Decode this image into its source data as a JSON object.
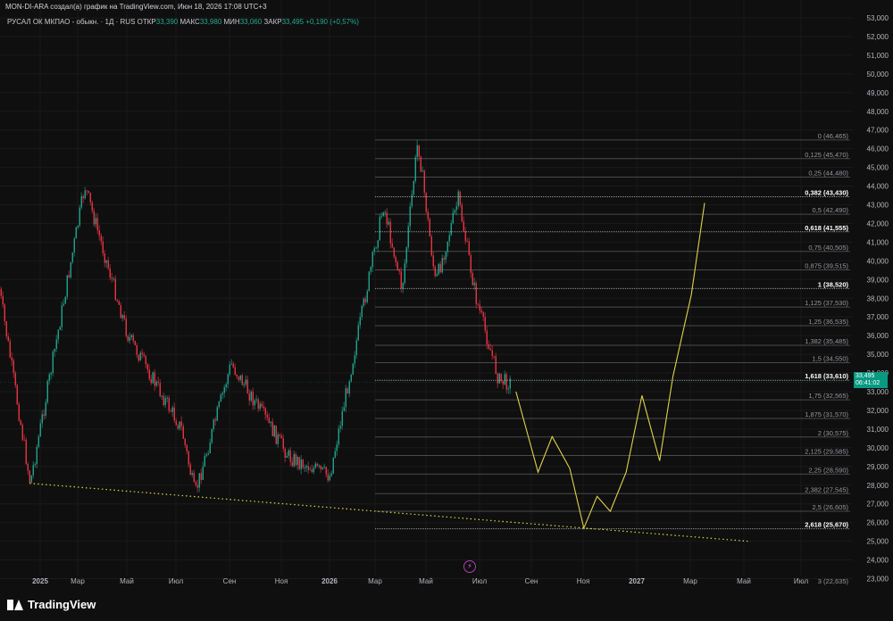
{
  "header": {
    "title": "MON-DI-ARA создал(а) график на TradingView.com, Июн 18, 2026 17:08 UTC+3"
  },
  "legend": {
    "symbol": "РУСАЛ ОК МКПАО - обыкн. · 1Д · RUS",
    "open_label": "ОТКР",
    "open": "33,390",
    "high_label": "МАКС",
    "high": "33,980",
    "low_label": "МИН",
    "low": "33,060",
    "close_label": "ЗАКР",
    "close": "33,495",
    "change": "+0,190 (+0,57%)"
  },
  "price_badge": {
    "price": "33,495",
    "countdown": "06:41:02"
  },
  "footer": {
    "brand": "TradingView"
  },
  "icons": {
    "brand_logo": "tradingview-logo-icon",
    "spark": "lightning-icon"
  },
  "colors": {
    "up": "#22ab94",
    "down": "#f23645",
    "projection": "#e0d34a",
    "trendline": "#e0d34a",
    "fib_line": "#6b6b6b",
    "badge": "#089981"
  },
  "chart_data": {
    "type": "candlestick",
    "y_axis_labels": [
      "53,000",
      "52,000",
      "51,000",
      "50,000",
      "49,000",
      "48,000",
      "47,000",
      "46,000",
      "45,000",
      "44,000",
      "43,000",
      "42,000",
      "41,000",
      "40,000",
      "39,000",
      "38,000",
      "37,000",
      "36,000",
      "35,000",
      "34,000",
      "33,000",
      "32,000",
      "31,000",
      "30,000",
      "29,000",
      "28,000",
      "27,000",
      "26,000",
      "25,000",
      "24,000",
      "23,000"
    ],
    "ylim": [
      22500,
      53000
    ],
    "x_axis_labels": [
      "2025",
      "Мар",
      "Май",
      "Июл",
      "Сен",
      "Ноя",
      "2026",
      "Мар",
      "Май",
      "Июл",
      "Сен",
      "Ноя",
      "2027",
      "Мар",
      "Май",
      "Июл"
    ],
    "price_path_key_points": [
      {
        "date": "2024-11-15",
        "price": 38500
      },
      {
        "date": "2024-12-20",
        "price": 28100
      },
      {
        "date": "2025-02-20",
        "price": 44000
      },
      {
        "date": "2025-04-10",
        "price": 36000
      },
      {
        "date": "2025-06-10",
        "price": 31000
      },
      {
        "date": "2025-06-25",
        "price": 27500
      },
      {
        "date": "2025-08-05",
        "price": 34500
      },
      {
        "date": "2025-10-10",
        "price": 29500
      },
      {
        "date": "2025-11-25",
        "price": 28500
      },
      {
        "date": "2026-01-25",
        "price": 43000
      },
      {
        "date": "2026-02-15",
        "price": 38500
      },
      {
        "date": "2026-03-05",
        "price": 46465
      },
      {
        "date": "2026-03-25",
        "price": 38800
      },
      {
        "date": "2026-04-20",
        "price": 43300
      },
      {
        "date": "2026-05-10",
        "price": 38000
      },
      {
        "date": "2026-06-05",
        "price": 33600
      },
      {
        "date": "2026-06-18",
        "price": 33495
      }
    ],
    "projection_path": [
      {
        "date": "2026-06-25",
        "price": 33000
      },
      {
        "date": "2026-07-20",
        "price": 28700
      },
      {
        "date": "2026-08-05",
        "price": 30600
      },
      {
        "date": "2026-08-25",
        "price": 28900
      },
      {
        "date": "2026-09-10",
        "price": 25700
      },
      {
        "date": "2026-09-25",
        "price": 27400
      },
      {
        "date": "2026-10-10",
        "price": 26600
      },
      {
        "date": "2026-10-28",
        "price": 28700
      },
      {
        "date": "2026-11-15",
        "price": 32800
      },
      {
        "date": "2026-12-05",
        "price": 29300
      },
      {
        "date": "2026-12-20",
        "price": 33800
      },
      {
        "date": "2027-01-10",
        "price": 38200
      },
      {
        "date": "2027-01-25",
        "price": 43100
      }
    ],
    "trendline": {
      "start": {
        "date": "2024-12-20",
        "price": 28100
      },
      "end": {
        "date": "2027-03-15",
        "price": 25000
      }
    },
    "fib_levels": [
      {
        "label": "0 (46,465)",
        "price": 46465,
        "bold": false
      },
      {
        "label": "0,125 (45,470)",
        "price": 45470,
        "bold": false
      },
      {
        "label": "0,25 (44,480)",
        "price": 44480,
        "bold": false
      },
      {
        "label": "0,382 (43,430)",
        "price": 43430,
        "bold": true
      },
      {
        "label": "0,5 (42,490)",
        "price": 42490,
        "bold": false
      },
      {
        "label": "0,618 (41,555)",
        "price": 41555,
        "bold": true
      },
      {
        "label": "0,75 (40,505)",
        "price": 40505,
        "bold": false
      },
      {
        "label": "0,875 (39,515)",
        "price": 39515,
        "bold": false
      },
      {
        "label": "1 (38,520)",
        "price": 38520,
        "bold": true
      },
      {
        "label": "1,125 (37,530)",
        "price": 37530,
        "bold": false
      },
      {
        "label": "1,25 (36,535)",
        "price": 36535,
        "bold": false
      },
      {
        "label": "1,382 (35,485)",
        "price": 35485,
        "bold": false
      },
      {
        "label": "1,5 (34,550)",
        "price": 34550,
        "bold": false
      },
      {
        "label": "1,618 (33,610)",
        "price": 33610,
        "bold": true
      },
      {
        "label": "1,75 (32,565)",
        "price": 32565,
        "bold": false
      },
      {
        "label": "1,875 (31,570)",
        "price": 31570,
        "bold": false
      },
      {
        "label": "2 (30,575)",
        "price": 30575,
        "bold": false
      },
      {
        "label": "2,125 (29,585)",
        "price": 29585,
        "bold": false
      },
      {
        "label": "2,25 (28,590)",
        "price": 28590,
        "bold": false
      },
      {
        "label": "2,382 (27,545)",
        "price": 27545,
        "bold": false
      },
      {
        "label": "2,5 (26,605)",
        "price": 26605,
        "bold": false
      },
      {
        "label": "2,618 (25,670)",
        "price": 25670,
        "bold": true
      },
      {
        "label": "3 (22,635)",
        "price": 22635,
        "bold": false
      }
    ]
  }
}
